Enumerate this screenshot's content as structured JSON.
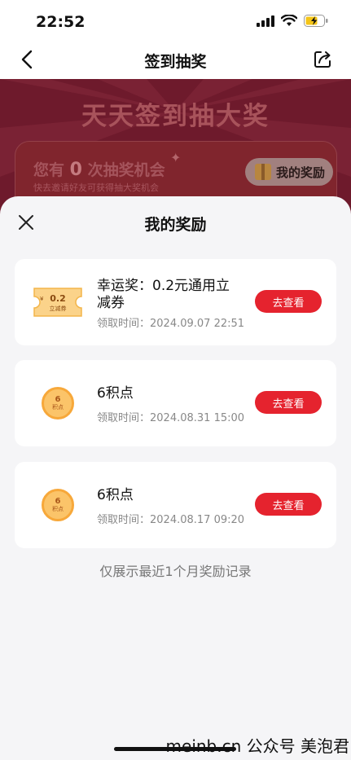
{
  "status": {
    "time": "22:52"
  },
  "nav": {
    "title": "签到抽奖"
  },
  "banner": {
    "title": "天天签到抽大奖",
    "chance_prefix": "您有",
    "chance_count": "0",
    "chance_suffix": "次抽奖机会",
    "chance_sub": "快去邀请好友可获得抽大奖机会",
    "my_reward_label": "我的奖励"
  },
  "sheet": {
    "title": "我的奖励",
    "items": [
      {
        "name": "幸运奖：0.2元通用立减券",
        "time": "领取时间：2024.09.07 22:51",
        "button": "去查看",
        "coupon_value": "0.2",
        "coupon_label": "立减券",
        "icon": "coupon-icon"
      },
      {
        "name": "6积点",
        "time": "领取时间：2024.08.31 15:00",
        "button": "去查看",
        "coin_value": "6",
        "coin_label": "积点",
        "icon": "coin-icon"
      },
      {
        "name": "6积点",
        "time": "领取时间：2024.08.17 09:20",
        "button": "去查看",
        "coin_value": "6",
        "coin_label": "积点",
        "icon": "coin-icon"
      }
    ],
    "footer_note": "仅展示最近1个月奖励记录"
  },
  "watermark": "meinb.cn 公众号 美泡君",
  "colors": {
    "accent": "#e5232e",
    "banner_bg": "#6e1a2c",
    "coin": "#fbc469"
  }
}
